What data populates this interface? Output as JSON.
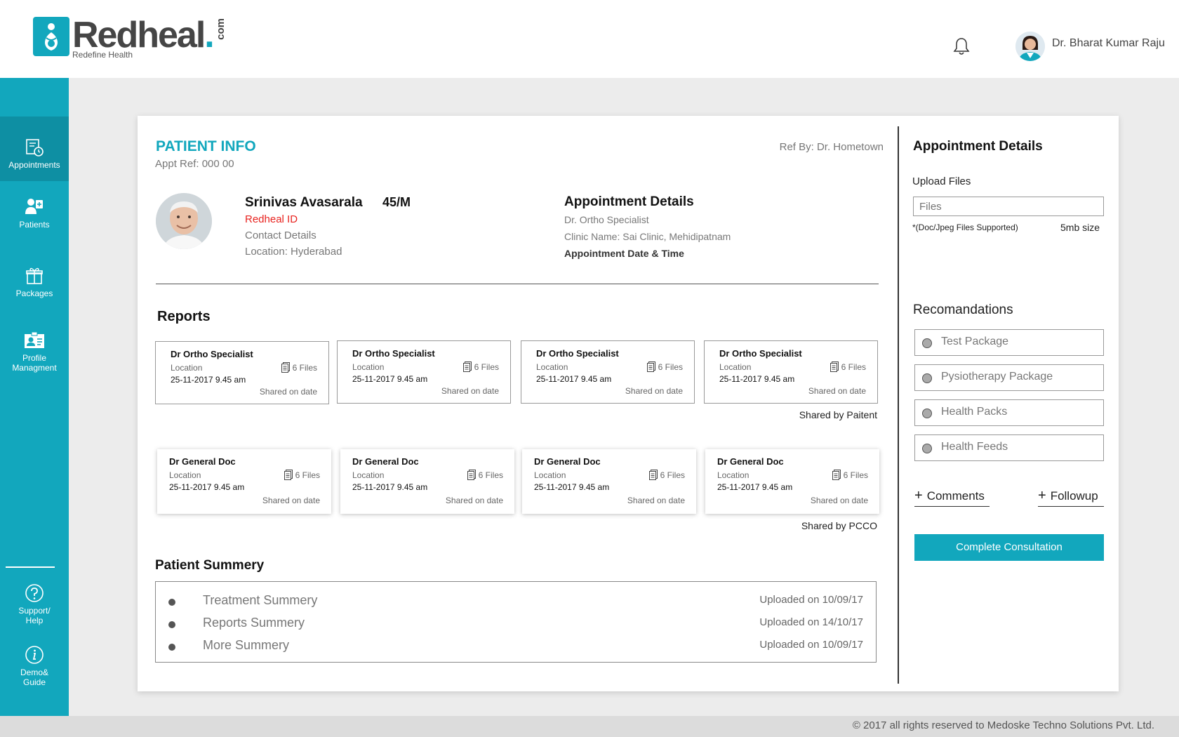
{
  "header": {
    "logo_text": "Redheal",
    "logo_dot": ".",
    "logo_com": "com",
    "logo_tagline": "Redefine Health",
    "user_name": "Dr. Bharat Kumar Raju",
    "bell_icon": "bell-icon"
  },
  "sidebar": {
    "items": [
      {
        "label": "Appointments",
        "icon": "appointments-icon",
        "active": true
      },
      {
        "label": "Patients",
        "icon": "patients-icon"
      },
      {
        "label": "Packages",
        "icon": "gift-icon"
      },
      {
        "label_line1": "Profile",
        "label_line2": "Managment",
        "icon": "profile-icon"
      }
    ],
    "bottom": [
      {
        "label_line1": "Support/",
        "label_line2": "Help",
        "icon": "help-icon"
      },
      {
        "label_line1": "Demo&",
        "label_line2": "Guide",
        "icon": "info-icon"
      }
    ]
  },
  "patient_info": {
    "title": "PATIENT INFO",
    "appt_ref": "Appt Ref: 000 00",
    "ref_by": "Ref By: Dr. Hometown",
    "name": "Srinivas Avasarala",
    "age_sex": "45/M",
    "redheal_id": "Redheal  ID",
    "contact": "Contact Details",
    "location": "Location: Hyderabad"
  },
  "appointment": {
    "title": "Appointment Details",
    "doctor": "Dr. Ortho Specialist",
    "clinic": "Clinic Name: Sai Clinic, Mehidipatnam",
    "datetime": "Appointment Date & Time"
  },
  "reports": {
    "title": "Reports",
    "patient_shared_label": "Shared by Paitent",
    "pcco_shared_label": "Shared by PCCO",
    "patient_cards": [
      {
        "title": "Dr Ortho Specialist",
        "location": "Location",
        "date": "25-11-2017   9.45 am",
        "files": "6 Files",
        "shared": "Shared on date"
      },
      {
        "title": "Dr Ortho Specialist",
        "location": "Location",
        "date": "25-11-2017   9.45 am",
        "files": "6 Files",
        "shared": "Shared on date"
      },
      {
        "title": "Dr Ortho Specialist",
        "location": "Location",
        "date": "25-11-2017   9.45 am",
        "files": "6 Files",
        "shared": "Shared on date"
      },
      {
        "title": "Dr Ortho Specialist",
        "location": "Location",
        "date": "25-11-2017   9.45 am",
        "files": "6 Files",
        "shared": "Shared on date"
      }
    ],
    "pcco_cards": [
      {
        "title": "Dr General Doc",
        "location": "Location",
        "date": "25-11-2017   9.45 am",
        "files": "6 Files",
        "shared": "Shared on date"
      },
      {
        "title": "Dr General Doc",
        "location": "Location",
        "date": "25-11-2017   9.45 am",
        "files": "6 Files",
        "shared": "Shared on date"
      },
      {
        "title": "Dr General Doc",
        "location": "Location",
        "date": "25-11-2017   9.45 am",
        "files": "6 Files",
        "shared": "Shared on date"
      },
      {
        "title": "Dr General Doc",
        "location": "Location",
        "date": "25-11-2017   9.45 am",
        "files": "6 Files",
        "shared": "Shared on date"
      }
    ]
  },
  "summary": {
    "title": "Patient Summery",
    "items": [
      {
        "label": "Treatment Summery",
        "uploaded": "Uploaded on 10/09/17"
      },
      {
        "label": "Reports Summery",
        "uploaded": "Uploaded on 14/10/17"
      },
      {
        "label": "More Summery",
        "uploaded": "Uploaded on 10/09/17"
      }
    ]
  },
  "right_panel": {
    "title": "Appointment Details",
    "upload_label": "Upload Files",
    "files_placeholder": "Files",
    "supported": "*(Doc/Jpeg Files Supported)",
    "size": "5mb size",
    "recommendations_title": "Recomandations",
    "recommendations": [
      "Test Package",
      "Pysiotherapy Package",
      "Health Packs",
      "Health Feeds"
    ],
    "comments_label": "Comments",
    "followup_label": "Followup",
    "complete_label": "Complete Consultation"
  },
  "footer": {
    "copyright": "© 2017 all rights reserved to Medoske Techno Solutions Pvt. Ltd."
  },
  "colors": {
    "accent": "#12a7bd",
    "accent_dark": "#0e8fa3",
    "red": "#e8231f"
  }
}
